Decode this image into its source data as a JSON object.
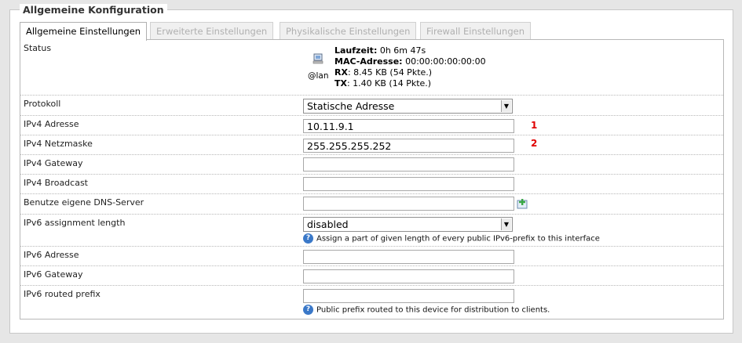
{
  "section_title": "Allgemeine Konfiguration",
  "tabs": [
    {
      "label": "Allgemeine Einstellungen",
      "active": true
    },
    {
      "label": "Erweiterte Einstellungen",
      "active": false
    },
    {
      "label": "Physikalische Einstellungen",
      "active": false
    },
    {
      "label": "Firewall Einstellungen",
      "active": false
    }
  ],
  "status": {
    "label": "Status",
    "interface": "@lan",
    "uptime_label": "Laufzeit:",
    "uptime_value": "0h 6m 47s",
    "mac_label": "MAC-Adresse:",
    "mac_value": "00:00:00:00:00:00",
    "rx_label": "RX",
    "rx_value": ": 8.45 KB (54 Pkte.)",
    "tx_label": "TX",
    "tx_value": ": 1.40 KB (14 Pkte.)"
  },
  "protocol": {
    "label": "Protokoll",
    "value": "Statische Adresse"
  },
  "ipv4_address": {
    "label": "IPv4 Adresse",
    "value": "10.11.9.1",
    "annotation": "1"
  },
  "ipv4_netmask": {
    "label": "IPv4 Netzmaske",
    "value": "255.255.255.252",
    "annotation": "2"
  },
  "ipv4_gateway": {
    "label": "IPv4 Gateway",
    "value": ""
  },
  "ipv4_broadcast": {
    "label": "IPv4 Broadcast",
    "value": ""
  },
  "dns": {
    "label": "Benutze eigene DNS-Server",
    "value": ""
  },
  "ipv6_assign": {
    "label": "IPv6 assignment length",
    "value": "disabled",
    "help": "Assign a part of given length of every public IPv6-prefix to this interface"
  },
  "ipv6_address": {
    "label": "IPv6 Adresse",
    "value": ""
  },
  "ipv6_gateway": {
    "label": "IPv6 Gateway",
    "value": ""
  },
  "ipv6_prefix": {
    "label": "IPv6 routed prefix",
    "value": "",
    "help": "Public prefix routed to this device for distribution to clients."
  },
  "colors": {
    "annotation": "#e00000",
    "help_icon": "#3a78c8",
    "add_icon": "#3aa845"
  }
}
